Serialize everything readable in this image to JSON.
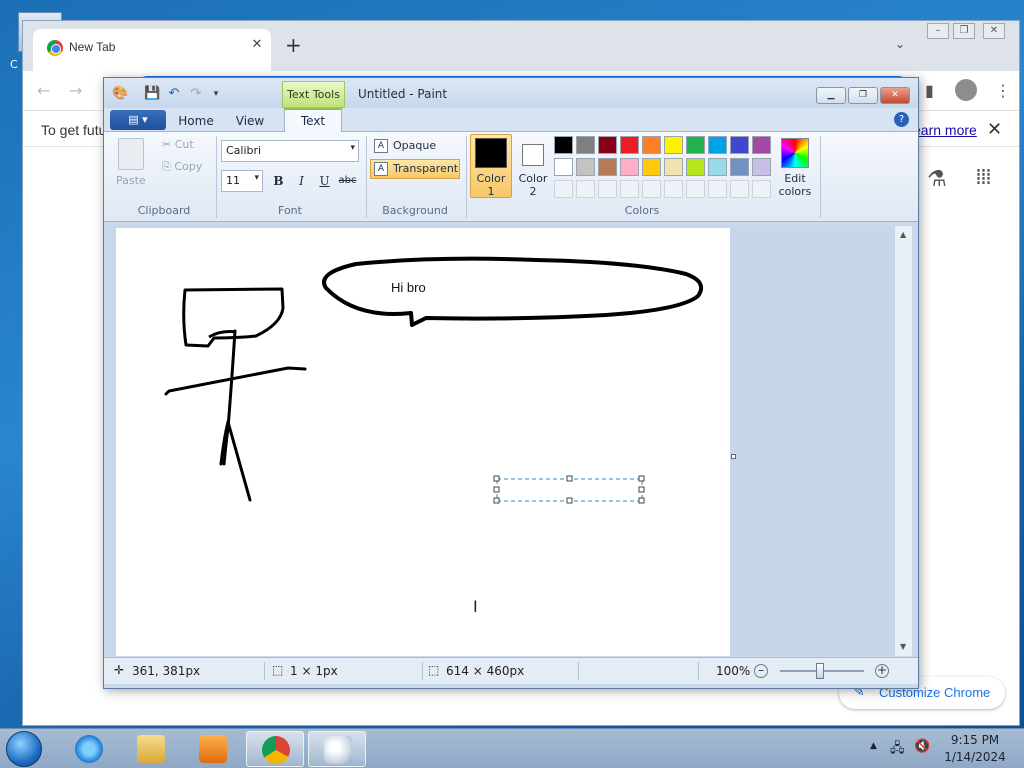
{
  "desktop": {
    "icon_label": "C"
  },
  "chrome": {
    "tab_title": "New Tab",
    "infobar_text": "To get futu",
    "infobar_link": "earn more",
    "customize_label": "Customize Chrome"
  },
  "paint": {
    "context_tab": "Text Tools",
    "title": "Untitled - Paint",
    "tabs": [
      "Home",
      "View",
      "Text"
    ],
    "active_tab": "Text",
    "clipboard": {
      "paste": "Paste",
      "cut": "Cut",
      "copy": "Copy",
      "group": "Clipboard"
    },
    "font": {
      "family": "Calibri",
      "size": "11",
      "bold": "B",
      "italic": "I",
      "underline": "U",
      "strike": "abc",
      "group": "Font"
    },
    "background": {
      "opaque": "Opaque",
      "transparent": "Transparent",
      "selected": "Transparent",
      "group": "Background"
    },
    "colors": {
      "group": "Colors",
      "color1_label_a": "Color",
      "color1_label_b": "1",
      "color2_label_a": "Color",
      "color2_label_b": "2",
      "color1": "#000000",
      "color2": "#ffffff",
      "edit_label_a": "Edit",
      "edit_label_b": "colors",
      "palette_row1": [
        "#000000",
        "#7f7f7f",
        "#880015",
        "#ed1c24",
        "#ff7f27",
        "#fff200",
        "#22b14c",
        "#00a2e8",
        "#3f48cc",
        "#a349a4"
      ],
      "palette_row2": [
        "#ffffff",
        "#c3c3c3",
        "#b97a57",
        "#ffaec9",
        "#ffc90e",
        "#efe4b0",
        "#b5e61d",
        "#99d9ea",
        "#7092be",
        "#c8bfe7"
      ]
    },
    "canvas": {
      "speech_text": "Hi bro"
    },
    "status": {
      "cursor_pos": "361, 381px",
      "selection_size": "1 × 1px",
      "image_size": "614 × 460px",
      "zoom": "100%"
    }
  },
  "taskbar": {
    "time": "9:15 PM",
    "date": "1/14/2024",
    "apps": [
      "internet-explorer",
      "windows-explorer",
      "media-player",
      "chrome",
      "paint"
    ],
    "active_app": "paint"
  }
}
